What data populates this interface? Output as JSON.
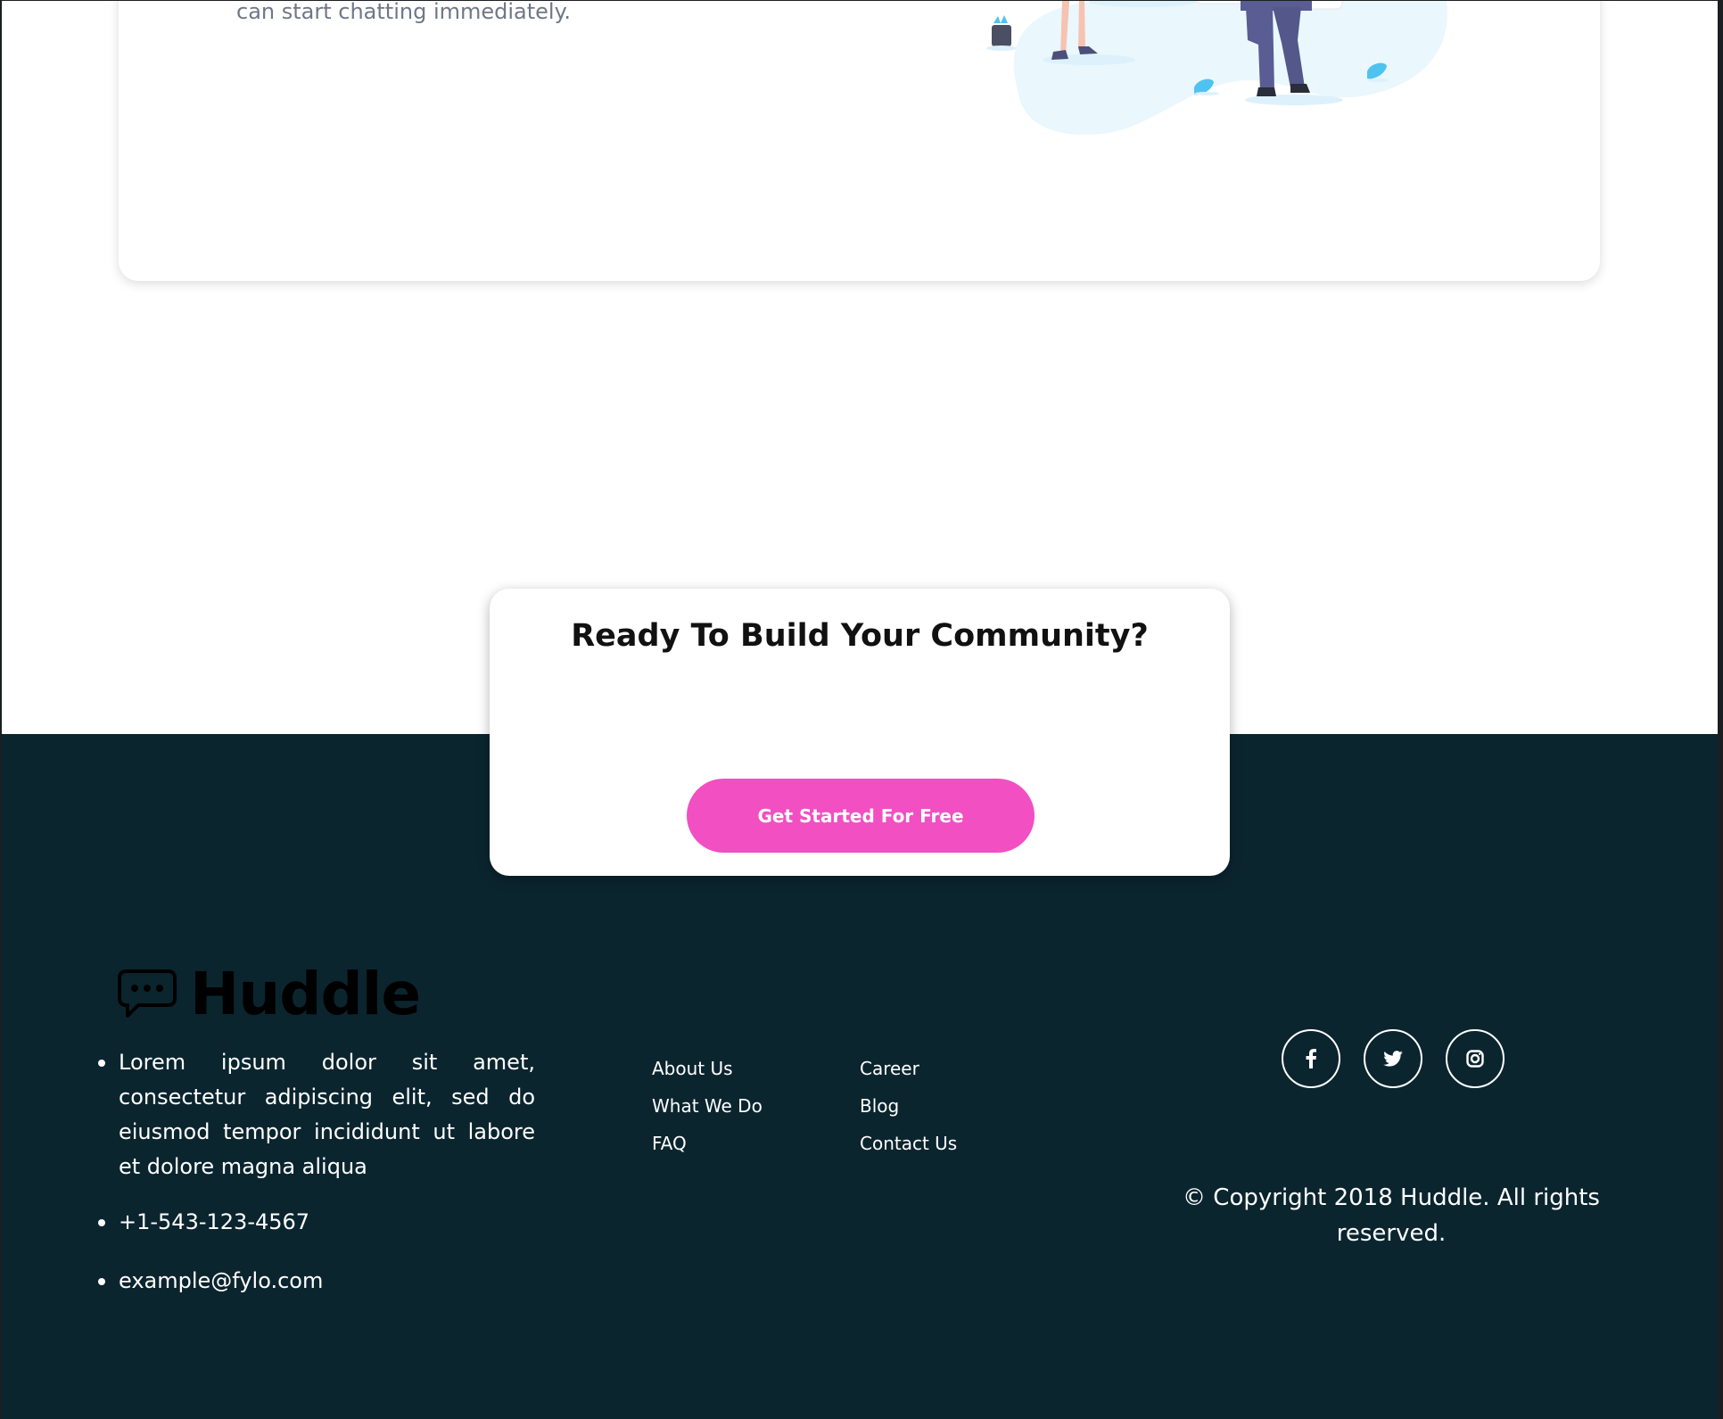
{
  "feature": {
    "text": "can start chatting immediately."
  },
  "cta": {
    "title": "Ready To Build Your Community?",
    "button_label": "Get Started For Free"
  },
  "footer": {
    "brand_name": "Huddle",
    "about": "Lorem ipsum dolor sit amet, consectetur adipiscing elit, sed do eiusmod tempor incididunt ut labore et dolore magna aliqua",
    "phone": "+1-543-123-4567",
    "email": "example@fylo.com",
    "links_col1": [
      "About Us",
      "What We Do",
      "FAQ"
    ],
    "links_col2": [
      "Career",
      "Blog",
      "Contact Us"
    ],
    "social_icons": [
      "facebook-icon",
      "twitter-icon",
      "instagram-icon"
    ],
    "copyright": "© Copyright 2018 Huddle. All rights reserved."
  },
  "colors": {
    "footer_bg": "#0b252f",
    "cta_button": "#f14fc2",
    "body_text": "#6f7787",
    "illustration_blob": "#eaf7fd",
    "illustration_accent": "#5a5d93"
  }
}
